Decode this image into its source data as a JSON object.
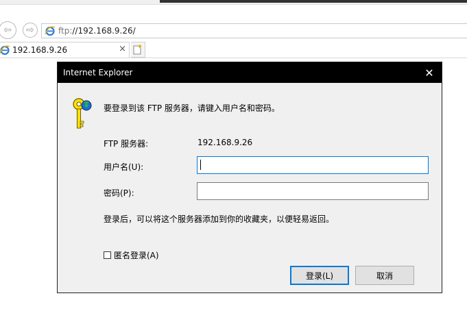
{
  "browser": {
    "address": {
      "protocol": "ftp:",
      "host_path": "//192.168.9.26/"
    },
    "tab": {
      "title": "192.168.9.26",
      "close_glyph": "×"
    },
    "icons": [
      "back-icon",
      "forward-icon",
      "ie-icon",
      "new-tab-icon"
    ]
  },
  "dialog": {
    "title": "Internet Explorer",
    "close_glyph": "✕",
    "prompt": "要登录到该 FTP 服务器，请键入用户名和密码。",
    "server_label": "FTP 服务器:",
    "server_value": "192.168.9.26",
    "username_label": "用户名(U):",
    "username_value": "",
    "password_label": "密码(P):",
    "password_value": "",
    "info": "登录后，可以将这个服务器添加到你的收藏夹，以便轻易返回。",
    "anonymous_label": "匿名登录(A)",
    "anonymous_checked": false,
    "login_button": "登录(L)",
    "cancel_button": "取消"
  }
}
